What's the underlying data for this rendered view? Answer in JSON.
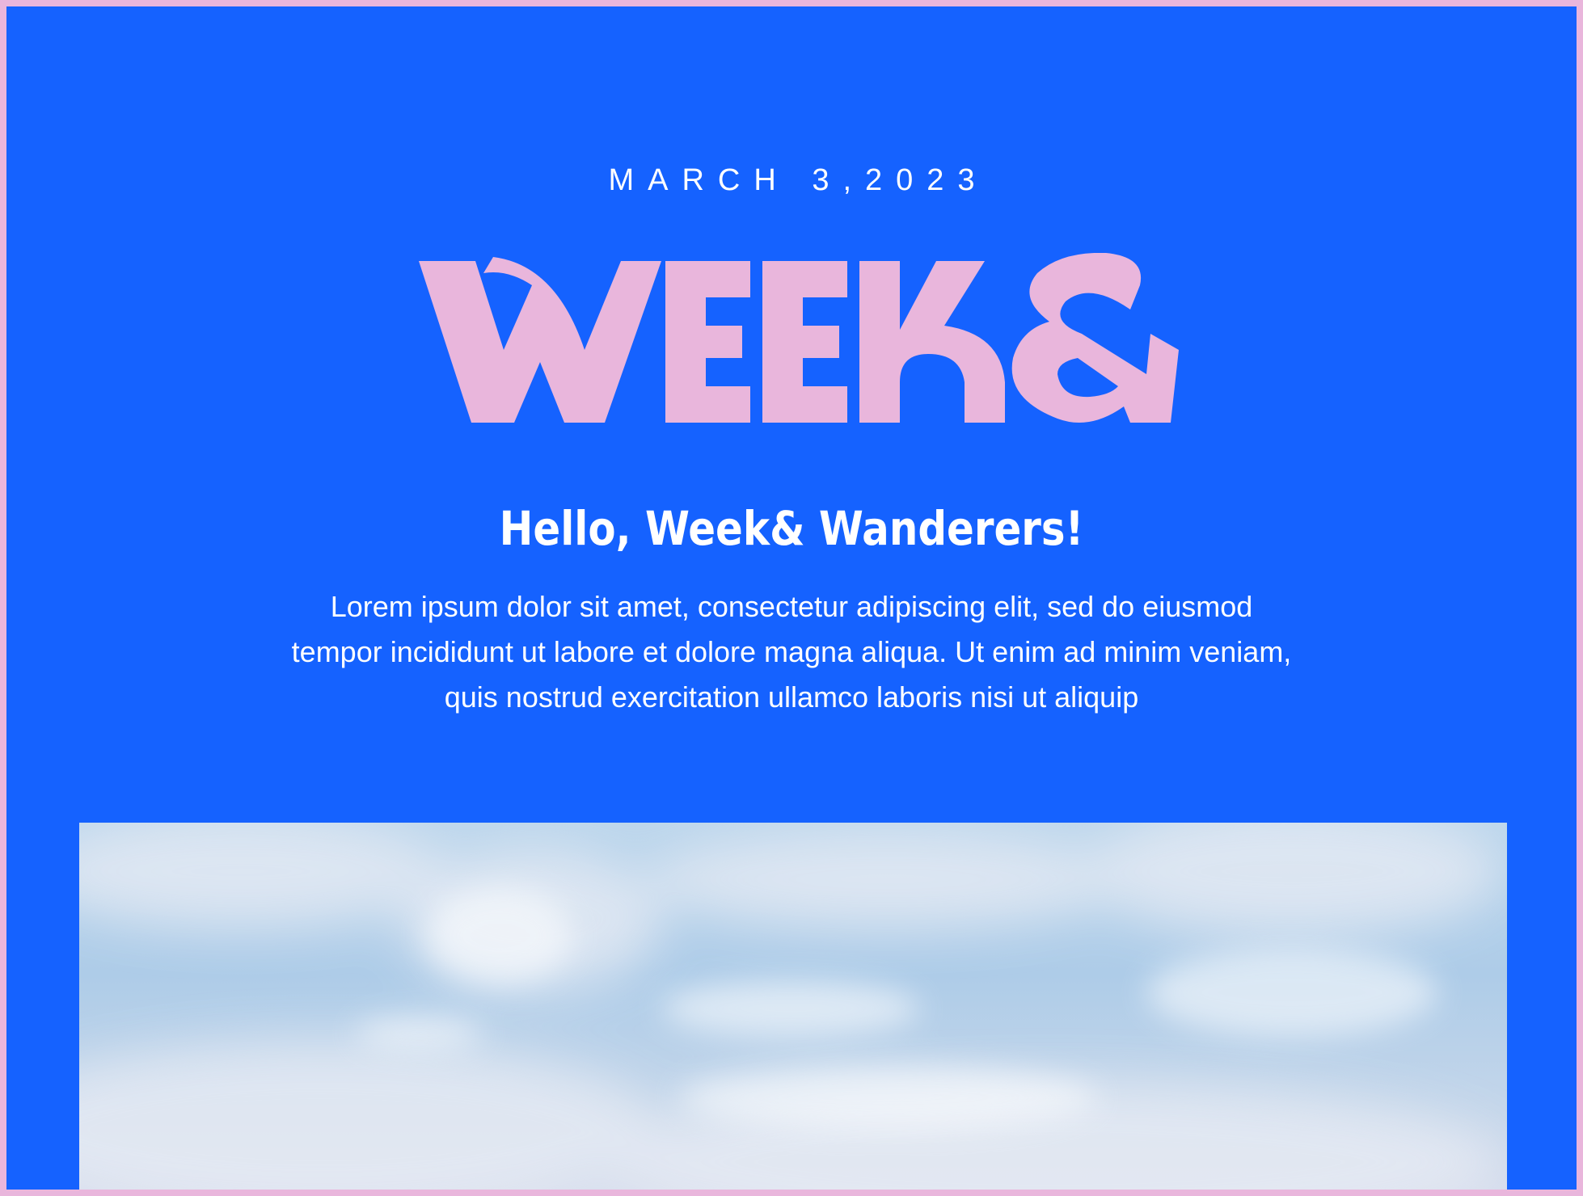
{
  "newsletter": {
    "date": "MARCH 3,2023",
    "logo_text": "WEEK&",
    "greeting": "Hello, Week& Wanderers!",
    "intro": "Lorem ipsum dolor sit amet, consectetur adipiscing elit, sed do eiusmod tempor incididunt ut labore et dolore magna aliqua. Ut enim ad minim veniam, quis nostrud exercitation ullamco laboris nisi ut aliquip"
  },
  "colors": {
    "background_blue": "#1562ff",
    "logo_pink": "#e9b6dc",
    "text_white": "#ffffff"
  }
}
